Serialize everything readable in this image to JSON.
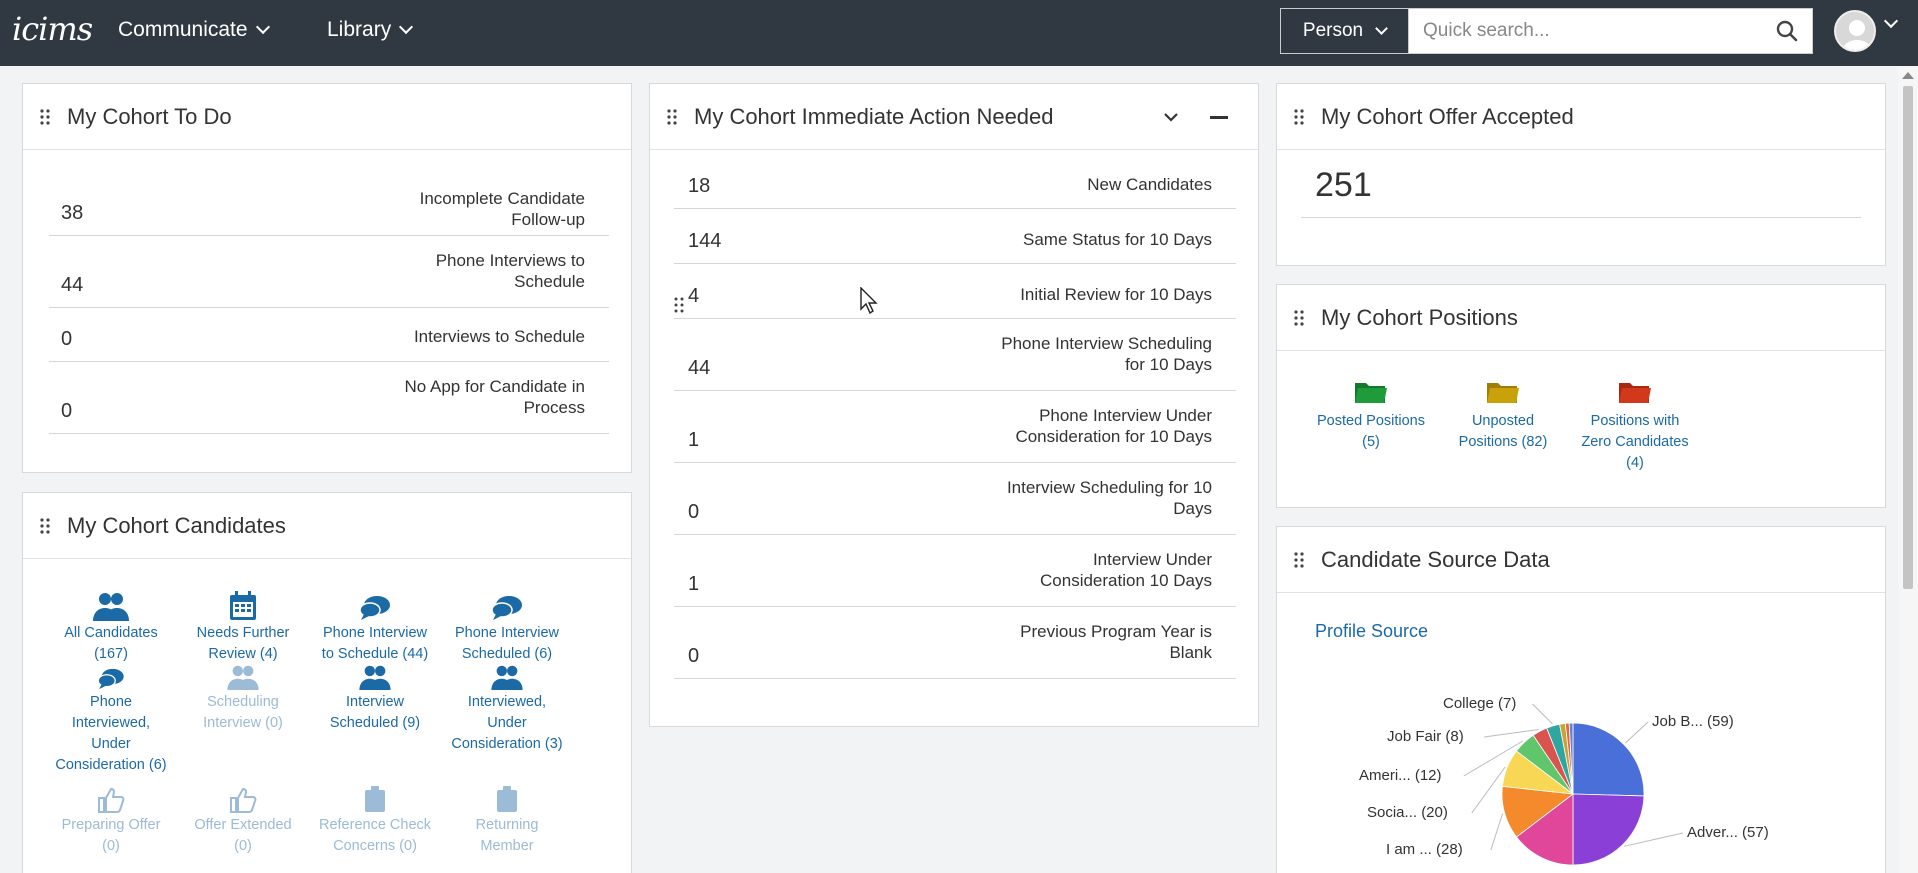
{
  "header": {
    "logo": "icims",
    "nav": [
      {
        "label": "Communicate"
      },
      {
        "label": "Library"
      }
    ],
    "search": {
      "scope": "Person",
      "placeholder": "Quick search..."
    }
  },
  "todo": {
    "title": "My Cohort To Do",
    "rows": [
      {
        "count": "38",
        "label1": "Incomplete Candidate",
        "label2": "Follow-up"
      },
      {
        "count": "44",
        "label1": "Phone Interviews to",
        "label2": "Schedule"
      },
      {
        "count": "0",
        "label1": "Interviews to Schedule",
        "label2": ""
      },
      {
        "count": "0",
        "label1": "No App for Candidate in",
        "label2": "Process"
      }
    ]
  },
  "immediate": {
    "title": "My Cohort Immediate Action Needed",
    "rows": [
      {
        "count": "18",
        "label1": "New Candidates",
        "label2": ""
      },
      {
        "count": "144",
        "label1": "Same Status for 10 Days",
        "label2": ""
      },
      {
        "count": "4",
        "label1": "Initial Review for 10 Days",
        "label2": ""
      },
      {
        "count": "44",
        "label1": "Phone Interview Scheduling",
        "label2": "for 10 Days"
      },
      {
        "count": "1",
        "label1": "Phone Interview Under",
        "label2": "Consideration for 10 Days"
      },
      {
        "count": "0",
        "label1": "Interview Scheduling for 10",
        "label2": "Days"
      },
      {
        "count": "1",
        "label1": "Interview Under",
        "label2": "Consideration 10 Days"
      },
      {
        "count": "0",
        "label1": "Previous Program Year is",
        "label2": "Blank"
      }
    ]
  },
  "offer": {
    "title": "My Cohort Offer Accepted",
    "value": "251"
  },
  "positions": {
    "title": "My Cohort Positions",
    "items": [
      {
        "l1": "Posted Positions",
        "l2": "(5)",
        "l3": "",
        "color": "#1e9b3a"
      },
      {
        "l1": "Unposted",
        "l2": "Positions (82)",
        "l3": "",
        "color": "#c9a20a"
      },
      {
        "l1": "Positions with",
        "l2": "Zero Candidates",
        "l3": "(4)",
        "color": "#d2381c"
      }
    ]
  },
  "candidates": {
    "title": "My Cohort Candidates",
    "items": [
      {
        "l1": "All Candidates",
        "l2": "(167)",
        "l3": "",
        "l4": "",
        "icon": "group-icon",
        "state": "active"
      },
      {
        "l1": "Needs Further",
        "l2": "Review (4)",
        "l3": "",
        "l4": "",
        "icon": "calendar-icon",
        "state": "active"
      },
      {
        "l1": "Phone Interview",
        "l2": "to Schedule (44)",
        "l3": "",
        "l4": "",
        "icon": "chat-icon",
        "state": "active"
      },
      {
        "l1": "Phone Interview",
        "l2": "Scheduled (6)",
        "l3": "",
        "l4": "",
        "icon": "chat-icon",
        "state": "active"
      },
      {
        "l1": "Phone",
        "l2": "Interviewed,",
        "l3": "Under",
        "l4": "Consideration (6)",
        "icon": "chat-icon",
        "state": "active"
      },
      {
        "l1": "Scheduling",
        "l2": "Interview (0)",
        "l3": "",
        "l4": "",
        "icon": "group-icon",
        "state": "dim"
      },
      {
        "l1": "Interview",
        "l2": "Scheduled (9)",
        "l3": "",
        "l4": "",
        "icon": "group-icon",
        "state": "active"
      },
      {
        "l1": "Interviewed,",
        "l2": "Under",
        "l3": "Consideration (3)",
        "l4": "",
        "icon": "group-icon",
        "state": "active"
      },
      {
        "l1": "Preparing Offer",
        "l2": "(0)",
        "l3": "",
        "l4": "",
        "icon": "thumbs-up-icon",
        "state": "dim"
      },
      {
        "l1": "Offer Extended",
        "l2": "(0)",
        "l3": "",
        "l4": "",
        "icon": "thumbs-up-icon",
        "state": "dim"
      },
      {
        "l1": "Reference Check",
        "l2": "Concerns (0)",
        "l3": "",
        "l4": "",
        "icon": "clipboard-icon",
        "state": "dim"
      },
      {
        "l1": "Returning",
        "l2": "Member",
        "l3": "",
        "l4": "",
        "icon": "clipboard-icon",
        "state": "dim"
      }
    ]
  },
  "source": {
    "title": "Candidate Source Data",
    "subtitle": "Profile Source"
  },
  "chart_data": {
    "type": "pie",
    "title": "Profile Source",
    "slices": [
      {
        "label": "Job B... (59)",
        "value": 59,
        "color": "#4a6fd8"
      },
      {
        "label": "Adver... (57)",
        "value": 57,
        "color": "#8a3fd6"
      },
      {
        "label": "",
        "value": 34,
        "color": "#e0479a"
      },
      {
        "label": "I am ... (28)",
        "value": 28,
        "color": "#f48a2c"
      },
      {
        "label": "Socia... (20)",
        "value": 20,
        "color": "#f7d754"
      },
      {
        "label": "Ameri... (12)",
        "value": 12,
        "color": "#5fc66b"
      },
      {
        "label": "Job Fair (8)",
        "value": 8,
        "color": "#d9534f"
      },
      {
        "label": "College (7)",
        "value": 7,
        "color": "#2fa7a0"
      },
      {
        "label": "",
        "value": 3,
        "color": "#c8a23b"
      },
      {
        "label": "",
        "value": 2,
        "color": "#e56a3a"
      },
      {
        "label": "",
        "value": 2,
        "color": "#6a86c8"
      }
    ]
  }
}
